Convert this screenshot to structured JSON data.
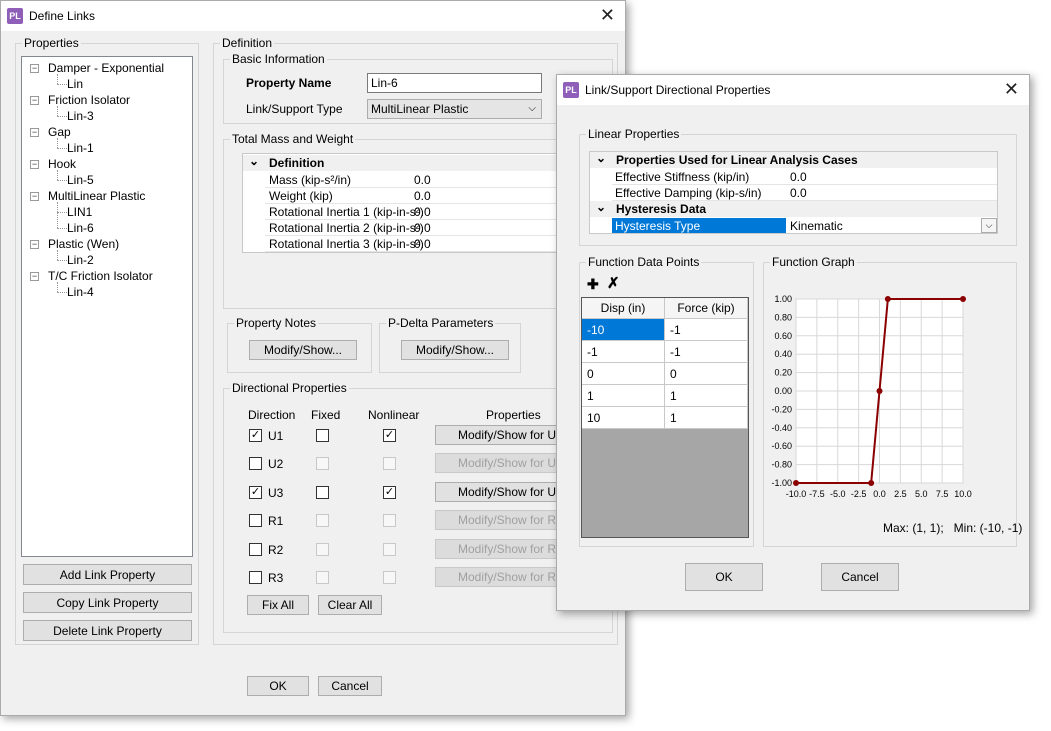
{
  "define_links": {
    "title": "Define Links",
    "properties_group": "Properties",
    "tree": [
      {
        "label": "Damper - Exponential",
        "children": [
          "Lin"
        ]
      },
      {
        "label": "Friction Isolator",
        "children": [
          "Lin-3"
        ]
      },
      {
        "label": "Gap",
        "children": [
          "Lin-1"
        ]
      },
      {
        "label": "Hook",
        "children": [
          "Lin-5"
        ]
      },
      {
        "label": "MultiLinear Plastic",
        "children": [
          "LIN1",
          "Lin-6"
        ]
      },
      {
        "label": "Plastic (Wen)",
        "children": [
          "Lin-2"
        ]
      },
      {
        "label": "T/C Friction Isolator",
        "children": [
          "Lin-4"
        ]
      }
    ],
    "add_button": "Add Link Property",
    "copy_button": "Copy Link Property",
    "delete_button": "Delete Link Property",
    "definition_group": "Definition",
    "basic_info_group": "Basic Information",
    "property_name_label": "Property Name",
    "property_name_value": "Lin-6",
    "link_type_label": "Link/Support Type",
    "link_type_value": "MultiLinear Plastic",
    "mass_group": "Total Mass and Weight",
    "mass_grid": {
      "header": "Definition",
      "rows": [
        {
          "label": "Mass (kip-s²/in)",
          "value": "0.0"
        },
        {
          "label": "Weight (kip)",
          "value": "0.0"
        },
        {
          "label": "Rotational Inertia 1 (kip-in-s²)",
          "value": "0.0"
        },
        {
          "label": "Rotational Inertia 2 (kip-in-s²)",
          "value": "0.0"
        },
        {
          "label": "Rotational Inertia 3 (kip-in-s²)",
          "value": "0.0"
        }
      ]
    },
    "notes_group": "Property Notes",
    "notes_button": "Modify/Show...",
    "pdelta_group": "P-Delta Parameters",
    "pdelta_button": "Modify/Show...",
    "directional_group": "Directional Properties",
    "dir_headers": {
      "direction": "Direction",
      "fixed": "Fixed",
      "nonlinear": "Nonlinear",
      "properties": "Properties"
    },
    "directions": [
      {
        "name": "U1",
        "checked": true,
        "fixed": false,
        "fixed_enabled": true,
        "nonlinear": true,
        "nonlinear_enabled": true,
        "button": "Modify/Show for U1...",
        "button_enabled": true
      },
      {
        "name": "U2",
        "checked": false,
        "fixed": false,
        "fixed_enabled": false,
        "nonlinear": false,
        "nonlinear_enabled": false,
        "button": "Modify/Show for U2...",
        "button_enabled": false
      },
      {
        "name": "U3",
        "checked": true,
        "fixed": false,
        "fixed_enabled": true,
        "nonlinear": true,
        "nonlinear_enabled": true,
        "button": "Modify/Show for U3...",
        "button_enabled": true
      },
      {
        "name": "R1",
        "checked": false,
        "fixed": false,
        "fixed_enabled": false,
        "nonlinear": false,
        "nonlinear_enabled": false,
        "button": "Modify/Show for R1...",
        "button_enabled": false
      },
      {
        "name": "R2",
        "checked": false,
        "fixed": false,
        "fixed_enabled": false,
        "nonlinear": false,
        "nonlinear_enabled": false,
        "button": "Modify/Show for R2...",
        "button_enabled": false
      },
      {
        "name": "R3",
        "checked": false,
        "fixed": false,
        "fixed_enabled": false,
        "nonlinear": false,
        "nonlinear_enabled": false,
        "button": "Modify/Show for R3...",
        "button_enabled": false
      }
    ],
    "fix_all_button": "Fix All",
    "clear_all_button": "Clear All",
    "ok_button": "OK",
    "cancel_button": "Cancel"
  },
  "directional_dialog": {
    "title": "Link/Support Directional Properties",
    "linear_group": "Linear Properties",
    "linear_section_header": "Properties Used for Linear Analysis Cases",
    "stiffness_label": "Effective Stiffness (kip/in)",
    "stiffness_value": "0.0",
    "damping_label": "Effective Damping (kip-s/in)",
    "damping_value": "0.0",
    "hysteresis_section_header": "Hysteresis Data",
    "hysteresis_label": "Hysteresis Type",
    "hysteresis_value": "Kinematic",
    "function_points_group": "Function Data Points",
    "table_headers": [
      "Disp (in)",
      "Force (kip)"
    ],
    "table_rows": [
      [
        "-10",
        "-1"
      ],
      [
        "-1",
        "-1"
      ],
      [
        "0",
        "0"
      ],
      [
        "1",
        "1"
      ],
      [
        "10",
        "1"
      ]
    ],
    "function_graph_group": "Function Graph",
    "graph_summary": "Max: (1, 1);   Min: (-10, -1)",
    "ok_button": "OK",
    "cancel_button": "Cancel"
  },
  "chart_data": {
    "type": "line",
    "x": [
      -10,
      -1,
      0,
      1,
      10
    ],
    "y": [
      -1,
      -1,
      0,
      1,
      1
    ],
    "xlim": [
      -10,
      10
    ],
    "ylim": [
      -1,
      1
    ],
    "x_ticks": [
      "-10.0",
      "-7.5",
      "-5.0",
      "-2.5",
      "0.0",
      "2.5",
      "5.0",
      "7.5",
      "10.0"
    ],
    "y_ticks": [
      "1.00",
      "0.80",
      "0.60",
      "0.40",
      "0.20",
      "0.00",
      "-0.20",
      "-0.40",
      "-0.60",
      "-0.80",
      "-1.00"
    ],
    "grid": true,
    "line_color": "#8b0000"
  }
}
